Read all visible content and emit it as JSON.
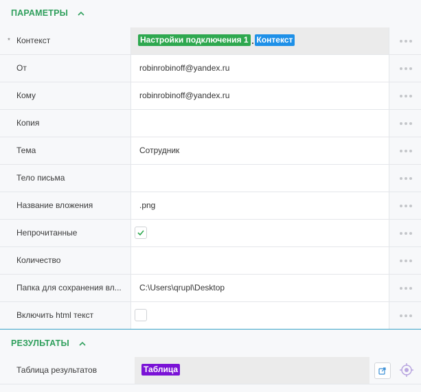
{
  "params": {
    "title": "ПАРАМЕТРЫ",
    "rows": [
      {
        "label": "Контекст",
        "required_mark": "*",
        "tag1": "Настройки подключения 1",
        "tag2": "Контекст"
      },
      {
        "label": "От",
        "value": "robinrobinoff@yandex.ru"
      },
      {
        "label": "Кому",
        "value": "robinrobinoff@yandex.ru"
      },
      {
        "label": "Копия",
        "value": ""
      },
      {
        "label": "Тема",
        "value": "Сотрудник"
      },
      {
        "label": "Тело письма",
        "value": ""
      },
      {
        "label": "Название вложения",
        "value": ".png"
      },
      {
        "label": "Непрочитанные",
        "checked": true
      },
      {
        "label": "Количество",
        "value": ""
      },
      {
        "label": "Папка для сохранения вл...",
        "value": "C:\\Users\\qrupl\\Desktop"
      },
      {
        "label": "Включить html текст",
        "checked": false
      }
    ]
  },
  "results": {
    "title": "РЕЗУЛЬТАТЫ",
    "rows": [
      {
        "label": "Таблица результатов",
        "tag": "Таблица"
      }
    ]
  },
  "colors": {
    "section_title": "#2f9f5c",
    "tag_green": "#2ea84f",
    "tag_blue": "#1e90e8",
    "tag_purple": "#7a12d6",
    "divider": "#3aa3c9"
  },
  "icons": {
    "collapse": "chevron-up-icon",
    "more": "more-dots-icon",
    "check": "check-icon",
    "open": "open-external-icon",
    "target": "crosshair-target-icon"
  }
}
